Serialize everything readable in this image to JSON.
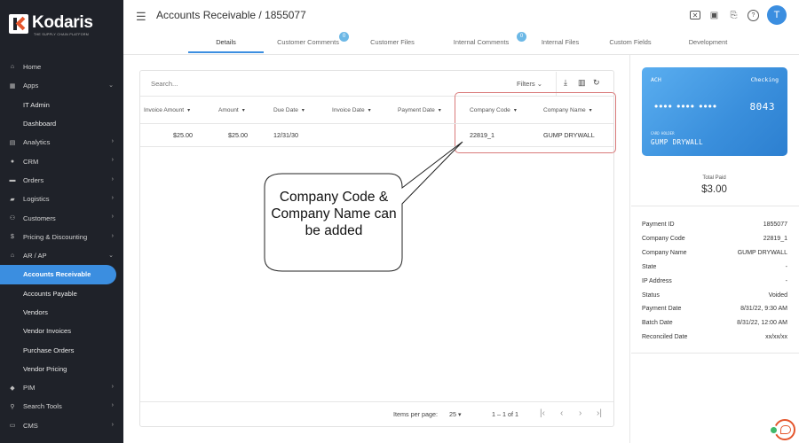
{
  "brand": {
    "name": "Kodaris",
    "tagline": "THE SUPPLY CHAIN PLATFORM"
  },
  "sidebar": {
    "items": [
      {
        "label": "Home",
        "icon": "home-icon",
        "glyph": "⌂",
        "chevron": ""
      },
      {
        "label": "Apps",
        "icon": "apps-icon",
        "glyph": "▦",
        "chevron": "⌄"
      },
      {
        "label": "IT Admin",
        "sub": true,
        "chevron": ""
      },
      {
        "label": "Dashboard",
        "sub": true,
        "chevron": ""
      },
      {
        "label": "Analytics",
        "icon": "analytics-icon",
        "glyph": "▤",
        "chevron": "›"
      },
      {
        "label": "CRM",
        "icon": "crm-icon",
        "glyph": "●",
        "chevron": "›"
      },
      {
        "label": "Orders",
        "icon": "orders-icon",
        "glyph": "▬",
        "chevron": "›"
      },
      {
        "label": "Logistics",
        "icon": "truck-icon",
        "glyph": "▰",
        "chevron": "›"
      },
      {
        "label": "Customers",
        "icon": "customers-icon",
        "glyph": "⚇",
        "chevron": "›"
      },
      {
        "label": "Pricing & Discounting",
        "icon": "dollar-icon",
        "glyph": "$",
        "chevron": "›"
      },
      {
        "label": "AR / AP",
        "icon": "bank-icon",
        "glyph": "⌂",
        "chevron": "⌄"
      },
      {
        "label": "Accounts Receivable",
        "sub": true,
        "active": true,
        "chevron": ""
      },
      {
        "label": "Accounts Payable",
        "sub": true,
        "chevron": ""
      },
      {
        "label": "Vendors",
        "sub": true,
        "chevron": ""
      },
      {
        "label": "Vendor Invoices",
        "sub": true,
        "chevron": ""
      },
      {
        "label": "Purchase Orders",
        "sub": true,
        "chevron": ""
      },
      {
        "label": "Vendor Pricing",
        "sub": true,
        "chevron": ""
      },
      {
        "label": "PIM",
        "icon": "tag-icon",
        "glyph": "◆",
        "chevron": "›"
      },
      {
        "label": "Search Tools",
        "icon": "search-icon",
        "glyph": "⚲",
        "chevron": "›"
      },
      {
        "label": "CMS",
        "icon": "cms-icon",
        "glyph": "▭",
        "chevron": "›"
      }
    ]
  },
  "header": {
    "title": "Accounts Receivable / 1855077",
    "avatar": "T"
  },
  "tabs": [
    {
      "label": "Details",
      "active": true
    },
    {
      "label": "Customer Comments",
      "badge": "0"
    },
    {
      "label": "Customer Files"
    },
    {
      "label": "Internal Comments",
      "badge": "0"
    },
    {
      "label": "Internal Files"
    },
    {
      "label": "Custom Fields"
    },
    {
      "label": "Development"
    }
  ],
  "grid": {
    "search_placeholder": "Search...",
    "filters_label": "Filters",
    "columns": [
      "Invoice Amount",
      "Amount",
      "Due Date",
      "Invoice Date",
      "Payment Date",
      "Company Code",
      "Company Name"
    ],
    "rows": [
      [
        "$25.00",
        "$25.00",
        "12/31/30",
        "",
        "",
        "22819_1",
        "GUMP DRYWALL"
      ]
    ],
    "footer": {
      "items_per_page_label": "Items per page:",
      "items_per_page": "25",
      "range": "1 – 1 of 1"
    }
  },
  "callout": {
    "text": "Company Code & Company Name can be added"
  },
  "payment_card": {
    "type": "ACH",
    "kind": "Checking",
    "masked": "•••• •••• ••••",
    "last4": "8043",
    "holder_label": "CARD HOLDER",
    "holder": "GUMP DRYWALL"
  },
  "total": {
    "label": "Total Paid",
    "value": "$3.00"
  },
  "details": [
    {
      "label": "Payment ID",
      "value": "1855077"
    },
    {
      "label": "Company Code",
      "value": "22819_1"
    },
    {
      "label": "Company Name",
      "value": "GUMP DRYWALL"
    },
    {
      "label": "State",
      "value": "-"
    },
    {
      "label": "IP Address",
      "value": "-"
    },
    {
      "label": "Status",
      "value": "Voided"
    },
    {
      "label": "Payment Date",
      "value": "8/31/22, 9:30 AM"
    },
    {
      "label": "Batch Date",
      "value": "8/31/22, 12:00 AM"
    },
    {
      "label": "Reconciled Date",
      "value": "xx/xx/xx"
    }
  ]
}
